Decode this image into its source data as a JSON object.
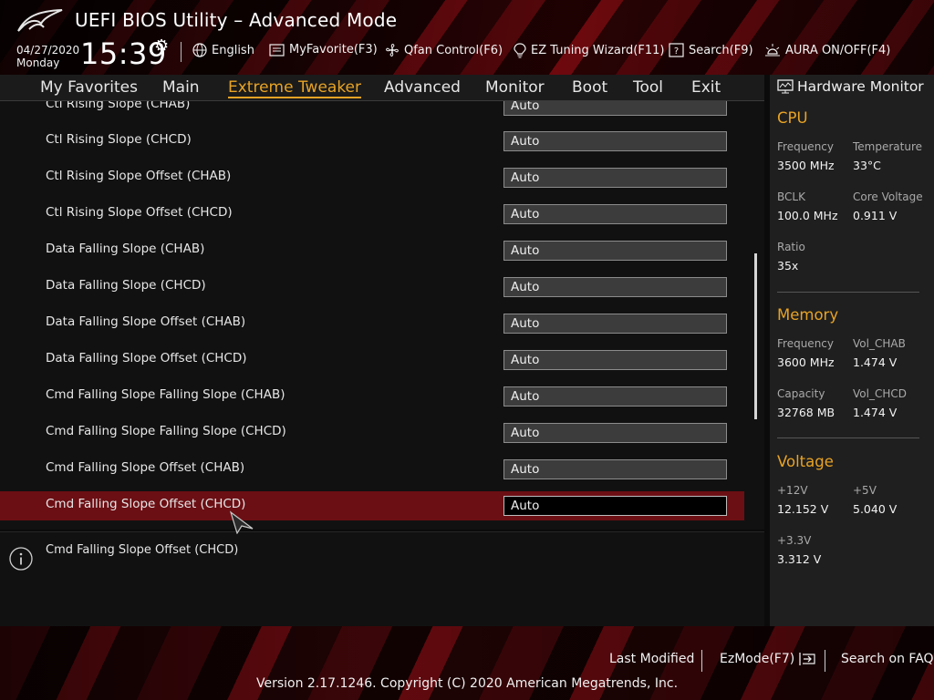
{
  "header": {
    "title": "UEFI BIOS Utility – Advanced Mode",
    "date": "04/27/2020",
    "day": "Monday",
    "time": "15:39",
    "toolbar": {
      "language": "English",
      "my_favorite": "MyFavorite(F3)",
      "qfan": "Qfan Control(F6)",
      "ez_tuning": "EZ Tuning Wizard(F11)",
      "search": "Search(F9)",
      "aura": "AURA ON/OFF(F4)"
    }
  },
  "menu": {
    "tabs": [
      {
        "label": "My Favorites"
      },
      {
        "label": "Main"
      },
      {
        "label": "Extreme Tweaker"
      },
      {
        "label": "Advanced"
      },
      {
        "label": "Monitor"
      },
      {
        "label": "Boot"
      },
      {
        "label": "Tool"
      },
      {
        "label": "Exit"
      }
    ],
    "active": "Extreme Tweaker"
  },
  "settings": [
    {
      "label": "Ctl Rising Slope (CHAB)",
      "value": "Auto"
    },
    {
      "label": "Ctl Rising Slope (CHCD)",
      "value": "Auto"
    },
    {
      "label": "Ctl Rising Slope Offset (CHAB)",
      "value": "Auto"
    },
    {
      "label": "Ctl Rising Slope Offset (CHCD)",
      "value": "Auto"
    },
    {
      "label": "Data Falling Slope (CHAB)",
      "value": "Auto"
    },
    {
      "label": "Data Falling Slope (CHCD)",
      "value": "Auto"
    },
    {
      "label": "Data Falling Slope Offset (CHAB)",
      "value": "Auto"
    },
    {
      "label": "Data Falling Slope Offset (CHCD)",
      "value": "Auto"
    },
    {
      "label": "Cmd Falling Slope Falling Slope (CHAB)",
      "value": "Auto"
    },
    {
      "label": "Cmd Falling Slope Falling Slope (CHCD)",
      "value": "Auto"
    },
    {
      "label": "Cmd Falling Slope Offset (CHAB)",
      "value": "Auto"
    },
    {
      "label": "Cmd Falling Slope Offset (CHCD)",
      "value": "Auto"
    }
  ],
  "selected_setting": "Cmd Falling Slope Offset (CHCD)",
  "help_text": "Cmd Falling Slope Offset (CHCD)",
  "hardware_monitor": {
    "title": "Hardware Monitor",
    "cpu": {
      "heading": "CPU",
      "frequency_label": "Frequency",
      "frequency": "3500 MHz",
      "temperature_label": "Temperature",
      "temperature": "33°C",
      "bclk_label": "BCLK",
      "bclk": "100.0 MHz",
      "core_voltage_label": "Core Voltage",
      "core_voltage": "0.911 V",
      "ratio_label": "Ratio",
      "ratio": "35x"
    },
    "memory": {
      "heading": "Memory",
      "frequency_label": "Frequency",
      "frequency": "3600 MHz",
      "vol_chab_label": "Vol_CHAB",
      "vol_chab": "1.474 V",
      "capacity_label": "Capacity",
      "capacity": "32768 MB",
      "vol_chcd_label": "Vol_CHCD",
      "vol_chcd": "1.474 V"
    },
    "voltage": {
      "heading": "Voltage",
      "v12_label": "+12V",
      "v12": "12.152 V",
      "v5_label": "+5V",
      "v5": "5.040 V",
      "v33_label": "+3.3V",
      "v33": "3.312 V"
    }
  },
  "footer": {
    "last_modified": "Last Modified",
    "ezmode": "EzMode(F7)",
    "search_faq": "Search on FAQ",
    "version": "Version 2.17.1246. Copyright (C) 2020 American Megatrends, Inc."
  },
  "colors": {
    "accent": "#e8a325",
    "selected_row": "#6b0f14",
    "brand_red": "#8c0d14"
  }
}
